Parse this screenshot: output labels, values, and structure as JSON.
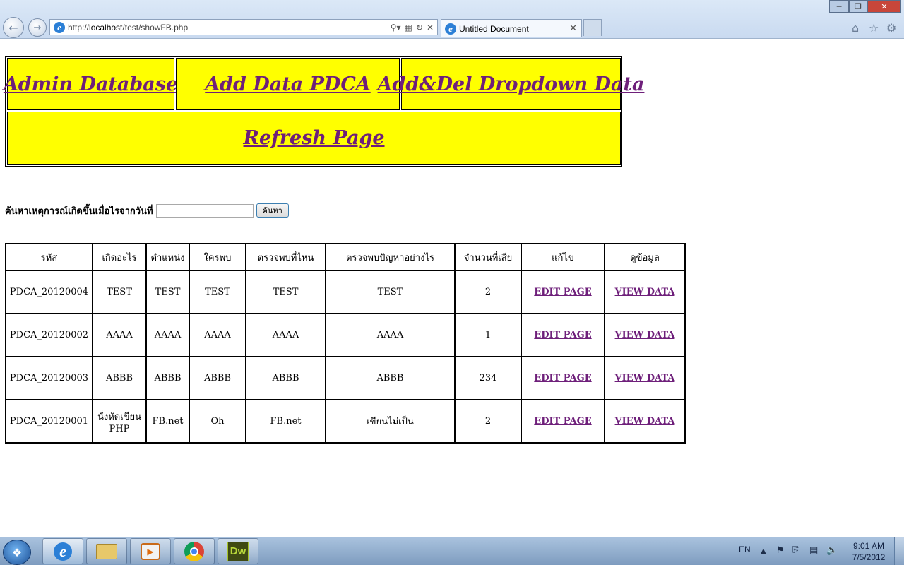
{
  "browser": {
    "url_prefix": "http://",
    "url_host": "localhost",
    "url_path": "/test/showFB.php",
    "tab_title": "Untitled Document"
  },
  "menu": {
    "admin_database": "Admin Database",
    "add_data_pdca": "Add Data PDCA",
    "add_del_dropdown": "Add&Del Dropdown Data",
    "refresh_page": "Refresh Page"
  },
  "search": {
    "label": "ค้นหาเหตุการณ์เกิดขึ้นเมื่อไรจากวันที่",
    "value": "",
    "button_label": "ค้นหา"
  },
  "table": {
    "headers": [
      "รหัส",
      "เกิดอะไร",
      "ตำแหน่ง",
      "ใครพบ",
      "ตรวจพบที่ไหน",
      "ตรวจพบปัญหาอย่างไร",
      "จำนวนที่เสีย",
      "แก้ไข",
      "ดูข้อมูล"
    ],
    "rows": [
      {
        "id": "PDCA_20120004",
        "what": "TEST",
        "position": "TEST",
        "who": "TEST",
        "where": "TEST",
        "how": "TEST",
        "loss": "2",
        "edit": "EDIT PAGE",
        "view": "VIEW DATA"
      },
      {
        "id": "PDCA_20120002",
        "what": "AAAA",
        "position": "AAAA",
        "who": "AAAA",
        "where": "AAAA",
        "how": "AAAA",
        "loss": "1",
        "edit": "EDIT PAGE",
        "view": "VIEW DATA"
      },
      {
        "id": "PDCA_20120003",
        "what": "ABBB",
        "position": "ABBB",
        "who": "ABBB",
        "where": "ABBB",
        "how": "ABBB",
        "loss": "234",
        "edit": "EDIT PAGE",
        "view": "VIEW DATA"
      },
      {
        "id": "PDCA_20120001",
        "what": "นั่งหัดเขียน PHP",
        "position": "FB.net",
        "who": "Oh",
        "where": "FB.net",
        "how": "เขียนไม่เป็น",
        "loss": "2",
        "edit": "EDIT PAGE",
        "view": "VIEW DATA"
      }
    ]
  },
  "taskbar": {
    "language": "EN",
    "time": "9:01 AM",
    "date": "7/5/2012",
    "dw_label": "Dw"
  },
  "colors": {
    "menu_background": "#ffff00",
    "link": "#6e1f7a"
  },
  "icons": {
    "back": "back-arrow-icon",
    "forward": "forward-arrow-icon",
    "home": "home-icon",
    "favorites": "star-icon",
    "tools": "gear-icon"
  }
}
